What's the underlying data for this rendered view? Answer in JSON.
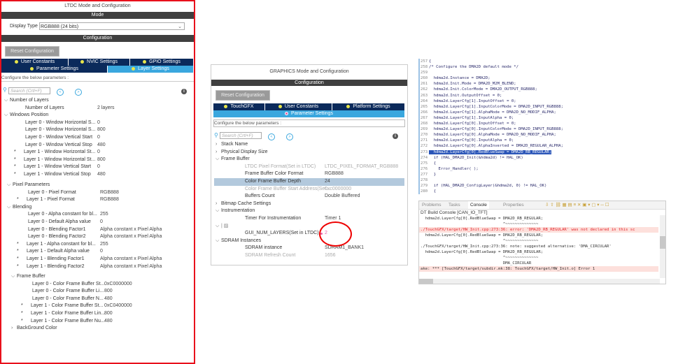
{
  "ltdc": {
    "title": "LTDC Mode and Configuration",
    "mode_bar": "Mode",
    "display_type_label": "Display Type",
    "display_type_value": "RGB888 (24 bits)",
    "config_bar": "Configuration",
    "reset_button": "Reset Configuration",
    "tabs": [
      "User Constants",
      "NVIC Settings",
      "GPIO Settings",
      "Parameter Settings",
      "Layer Settings"
    ],
    "configure_text": "Configure the below parameters :",
    "search_placeholder": "Search (Crtl+F)",
    "groups": [
      [
        {
          "l": 0,
          "label": "Number of Layers",
          "chev": "v"
        },
        {
          "l": 2,
          "label": "Number of Layers",
          "value": "2 layers"
        },
        {
          "l": 0,
          "label": "Windows Position",
          "chev": "v"
        },
        {
          "l": 2,
          "label": "Layer 0 - Window Horizontal S...",
          "value": "0"
        },
        {
          "l": 2,
          "label": "Layer 0 - Window Horizontal S...",
          "value": "800"
        },
        {
          "l": 2,
          "label": "Layer 0 - Window Vertical Start",
          "value": "0"
        },
        {
          "l": 2,
          "label": "Layer 0 - Window Vertical Stop",
          "value": "480"
        },
        {
          "l": 2,
          "star": true,
          "label": "Layer 1 - Window Horizontal St...",
          "value": "0"
        },
        {
          "l": 2,
          "star": true,
          "label": "Layer 1 - Window Horizontal St...",
          "value": "800"
        },
        {
          "l": 2,
          "star": true,
          "label": "Layer 1 - Window Vertical Start",
          "value": "0"
        },
        {
          "l": 2,
          "star": true,
          "label": "Layer 1 - Window Vertical Stop",
          "value": "480"
        }
      ],
      [
        {
          "l": 0,
          "label": "Pixel Parameters",
          "chev": "v"
        },
        {
          "l": 2,
          "label": "Layer 0 - Pixel Format",
          "value": "RGB888"
        },
        {
          "l": 2,
          "star": true,
          "label": "Layer 1 - Pixel Format",
          "value": "RGB888"
        },
        {
          "l": 0,
          "label": "Blending",
          "chev": "v"
        },
        {
          "l": 2,
          "label": "Layer 0 - Alpha constant for bl...",
          "value": "255"
        },
        {
          "l": 2,
          "label": "Layer 0 - Default Alpha value",
          "value": "0"
        },
        {
          "l": 2,
          "label": "Layer 0 - Blending Factor1",
          "value": "Alpha constant x Pixel Alpha"
        },
        {
          "l": 2,
          "label": "Layer 0 - Blending Factor2",
          "value": "Alpha constant x Pixel Alpha"
        },
        {
          "l": 2,
          "star": true,
          "label": "Layer 1 - Alpha constant for bl...",
          "value": "255"
        },
        {
          "l": 2,
          "star": true,
          "label": "Layer 1 - Default Alpha value",
          "value": "0"
        },
        {
          "l": 2,
          "star": true,
          "label": "Layer 1 - Blending Factor1",
          "value": "Alpha constant x Pixel Alpha"
        },
        {
          "l": 2,
          "star": true,
          "label": "Layer 1 - Blending Factor2",
          "value": "Alpha constant x Pixel Alpha"
        }
      ],
      [
        {
          "l": 0,
          "label": "Frame Buffer",
          "chev": "v"
        },
        {
          "l": 2,
          "label": "Layer 0 - Color Frame Buffer St...",
          "value": "0xC0000000"
        },
        {
          "l": 2,
          "label": "Layer 0 - Color Frame Buffer Li...",
          "value": "800"
        },
        {
          "l": 2,
          "label": "Layer 0 - Color Frame Buffer N...",
          "value": "480"
        },
        {
          "l": 2,
          "star": true,
          "label": "Layer 1 - Color Frame Buffer St...",
          "value": "0xC0400000"
        },
        {
          "l": 2,
          "star": true,
          "label": "Layer 1 - Color Frame Buffer Lin...",
          "value": "800"
        },
        {
          "l": 2,
          "star": true,
          "label": "Layer 1 - Color Frame Buffer Nu...",
          "value": "480"
        }
      ],
      [
        {
          "l": 0,
          "label": "BackGround Color",
          "chev": ">"
        }
      ]
    ]
  },
  "graphics": {
    "title": "GRAPHICS Mode and Configuration",
    "config_bar": "Configuration",
    "reset_button": "Reset Configuration",
    "tabs": [
      "TouchGFX",
      "User Constants",
      "Platform Settings",
      "Parameter Settings"
    ],
    "configure_text": "Configure the below parameters :",
    "search_placeholder": "Search (Crtl+F)",
    "rows": [
      {
        "l": 0,
        "label": "Stack Name",
        "chev": ">"
      },
      {
        "l": 0,
        "label": "Physical Display Size",
        "chev": ">"
      },
      {
        "l": 0,
        "label": "Frame Buffer",
        "chev": "v"
      },
      {
        "l": 2,
        "label": "LTDC Pixel Format(Set in LTDC)",
        "value": "LTDC_PIXEL_FORMAT_RGB888",
        "dim": true
      },
      {
        "l": 2,
        "label": "Frame Buffer Color Format",
        "value": "RGB888"
      },
      {
        "l": 2,
        "label": "Color Frame Buffer Depth",
        "value": "24",
        "hl": true
      },
      {
        "l": 2,
        "label": "Color Frame Buffer Start Address(Set...",
        "value": "0xc0000000",
        "dim": true
      },
      {
        "l": 2,
        "label": "Buffers Count",
        "value": "Double Buffered"
      },
      {
        "l": 0,
        "label": "Bitmap Cache Settings",
        "chev": ">"
      },
      {
        "l": 0,
        "label": "Instrumentation",
        "chev": "v"
      },
      {
        "l": 2,
        "label": "Timer For Instrumentation",
        "value": "Timer 1"
      },
      {
        "l": 0,
        "label": "",
        "chev": "v",
        "icon": true
      },
      {
        "l": 2,
        "label": "GUI_NUM_LAYERS(Set in LTDC)",
        "value": "2",
        "pink": true
      },
      {
        "l": 0,
        "label": "SDRAM Instances",
        "chev": "v"
      },
      {
        "l": 2,
        "label": "SDRAM instance",
        "value": "SDRAM1_BANK1"
      },
      {
        "l": 2,
        "label": "SDRAM Refresh Count",
        "value": "1656",
        "dim": true
      }
    ]
  },
  "code": {
    "lines": [
      {
        "n": "257",
        "t": "{"
      },
      {
        "n": "258",
        "t": "/* Configure the DMA2D default mode */"
      },
      {
        "n": "259",
        "t": ""
      },
      {
        "n": "260",
        "t": "  hdma2d.Instance = DMA2D;"
      },
      {
        "n": "261",
        "t": "  hdma2d.Init.Mode = DMA2D_M2M_BLEND;"
      },
      {
        "n": "262",
        "t": "  hdma2d.Init.ColorMode = DMA2D_OUTPUT_RGB888;"
      },
      {
        "n": "263",
        "t": "  hdma2d.Init.OutputOffset = 0;"
      },
      {
        "n": "264",
        "t": "  hdma2d.LayerCfg[1].InputOffset = 0;"
      },
      {
        "n": "265",
        "t": "  hdma2d.LayerCfg[1].InputColorMode = DMA2D_INPUT_RGB888;"
      },
      {
        "n": "266",
        "t": "  hdma2d.LayerCfg[1].AlphaMode = DMA2D_NO_MODIF_ALPHA;"
      },
      {
        "n": "267",
        "t": "  hdma2d.LayerCfg[1].InputAlpha = 0;"
      },
      {
        "n": "268",
        "t": "  hdma2d.LayerCfg[0].InputOffset = 0;"
      },
      {
        "n": "269",
        "t": "  hdma2d.LayerCfg[0].InputColorMode = DMA2D_INPUT_RGB888;"
      },
      {
        "n": "270",
        "t": "  hdma2d.LayerCfg[0].AlphaMode = DMA2D_NO_MODIF_ALPHA;"
      },
      {
        "n": "271",
        "t": "  hdma2d.LayerCfg[0].InputAlpha = 0;"
      },
      {
        "n": "272",
        "t": "  hdma2d.LayerCfg[0].AlphaInverted = DMA2D_REGULAR_ALPHA;"
      },
      {
        "n": "273",
        "t": "  hdma2d.LayerCfg[0].RedBlueSwap = DMA2D_RB_REGULAR;",
        "sel": true
      },
      {
        "n": "274",
        "t": "  if (HAL_DMA2D_Init(&hdma2d) != HAL_OK)"
      },
      {
        "n": "275",
        "t": "  {"
      },
      {
        "n": "276",
        "t": "    Error_Handler( );"
      },
      {
        "n": "277",
        "t": "  }"
      },
      {
        "n": "278",
        "t": ""
      },
      {
        "n": "279",
        "t": "  if (HAL_DMA2D_ConfigLayer(&hdma2d, 0) != HAL_OK)"
      },
      {
        "n": "280",
        "t": "  {"
      }
    ]
  },
  "console": {
    "tabs": [
      "Problems",
      "Tasks",
      "Console",
      "Properties"
    ],
    "header": "DT Build Console [CAN_IO_TFT]",
    "lines": [
      {
        "t": "  hdma2d.LayerCfg[0].RedBlueSwap = DMA2D_RB_REGULAR;"
      },
      {
        "t": "                                   ^~~~~~~~~~~~~~~"
      },
      {
        "t": "./TouchGFX/target/HW_Init.cpp:273:36: error: 'DMA2D_RB_REGULAR' was not declared in this sc",
        "k": "err"
      },
      {
        "t": "  hdma2d.LayerCfg[0].RedBlueSwap = DMA2D_RB_REGULAR;"
      },
      {
        "t": "                                   ^~~~~~~~~~~~~~~"
      },
      {
        "t": "./TouchGFX/target/HW_Init.cpp:273:36: note: suggested alternative: 'DMA_CIRCULAR'"
      },
      {
        "t": "  hdma2d.LayerCfg[0].RedBlueSwap = DMA2D_RB_REGULAR;"
      },
      {
        "t": "                                   ^~~~~~~~~~~~~~~"
      },
      {
        "t": "                                   DMA_CIRCULAR"
      },
      {
        "t": "ake: *** [TouchGFX/target/subdir.mk:38: TouchGFX/target/HW_Init.o] Error 1",
        "k": "err2"
      }
    ]
  }
}
